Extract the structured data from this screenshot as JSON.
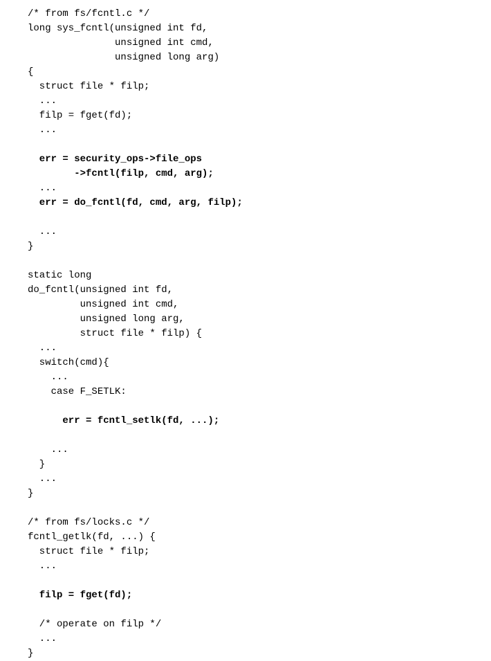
{
  "lines": [
    {
      "text": "/* from fs/fcntl.c */",
      "bold": false
    },
    {
      "text": "long sys_fcntl(unsigned int fd,",
      "bold": false
    },
    {
      "text": "               unsigned int cmd,",
      "bold": false
    },
    {
      "text": "               unsigned long arg)",
      "bold": false
    },
    {
      "text": "{",
      "bold": false
    },
    {
      "text": "  struct file * filp;",
      "bold": false
    },
    {
      "text": "  ...",
      "bold": false
    },
    {
      "text": "  filp = fget(fd);",
      "bold": false
    },
    {
      "text": "  ...",
      "bold": false
    },
    {
      "text": "",
      "bold": false
    },
    {
      "text": "  err = security_ops->file_ops",
      "bold": true
    },
    {
      "text": "        ->fcntl(filp, cmd, arg);",
      "bold": true
    },
    {
      "text": "  ...",
      "bold": false
    },
    {
      "text": "  err = do_fcntl(fd, cmd, arg, filp);",
      "bold": true
    },
    {
      "text": "",
      "bold": false
    },
    {
      "text": "  ...",
      "bold": false
    },
    {
      "text": "}",
      "bold": false
    },
    {
      "text": "",
      "bold": false
    },
    {
      "text": "static long",
      "bold": false
    },
    {
      "text": "do_fcntl(unsigned int fd,",
      "bold": false
    },
    {
      "text": "         unsigned int cmd,",
      "bold": false
    },
    {
      "text": "         unsigned long arg,",
      "bold": false
    },
    {
      "text": "         struct file * filp) {",
      "bold": false
    },
    {
      "text": "  ...",
      "bold": false
    },
    {
      "text": "  switch(cmd){",
      "bold": false
    },
    {
      "text": "    ...",
      "bold": false
    },
    {
      "text": "    case F_SETLK:",
      "bold": false
    },
    {
      "text": "",
      "bold": false
    },
    {
      "text": "      err = fcntl_setlk(fd, ...);",
      "bold": true
    },
    {
      "text": "",
      "bold": false
    },
    {
      "text": "    ...",
      "bold": false
    },
    {
      "text": "  }",
      "bold": false
    },
    {
      "text": "  ...",
      "bold": false
    },
    {
      "text": "}",
      "bold": false
    },
    {
      "text": "",
      "bold": false
    },
    {
      "text": "/* from fs/locks.c */",
      "bold": false
    },
    {
      "text": "fcntl_getlk(fd, ...) {",
      "bold": false
    },
    {
      "text": "  struct file * filp;",
      "bold": false
    },
    {
      "text": "  ...",
      "bold": false
    },
    {
      "text": "",
      "bold": false
    },
    {
      "text": "  filp = fget(fd);",
      "bold": true
    },
    {
      "text": "",
      "bold": false
    },
    {
      "text": "  /* operate on filp */",
      "bold": false
    },
    {
      "text": "  ...",
      "bold": false
    },
    {
      "text": "}",
      "bold": false
    }
  ]
}
